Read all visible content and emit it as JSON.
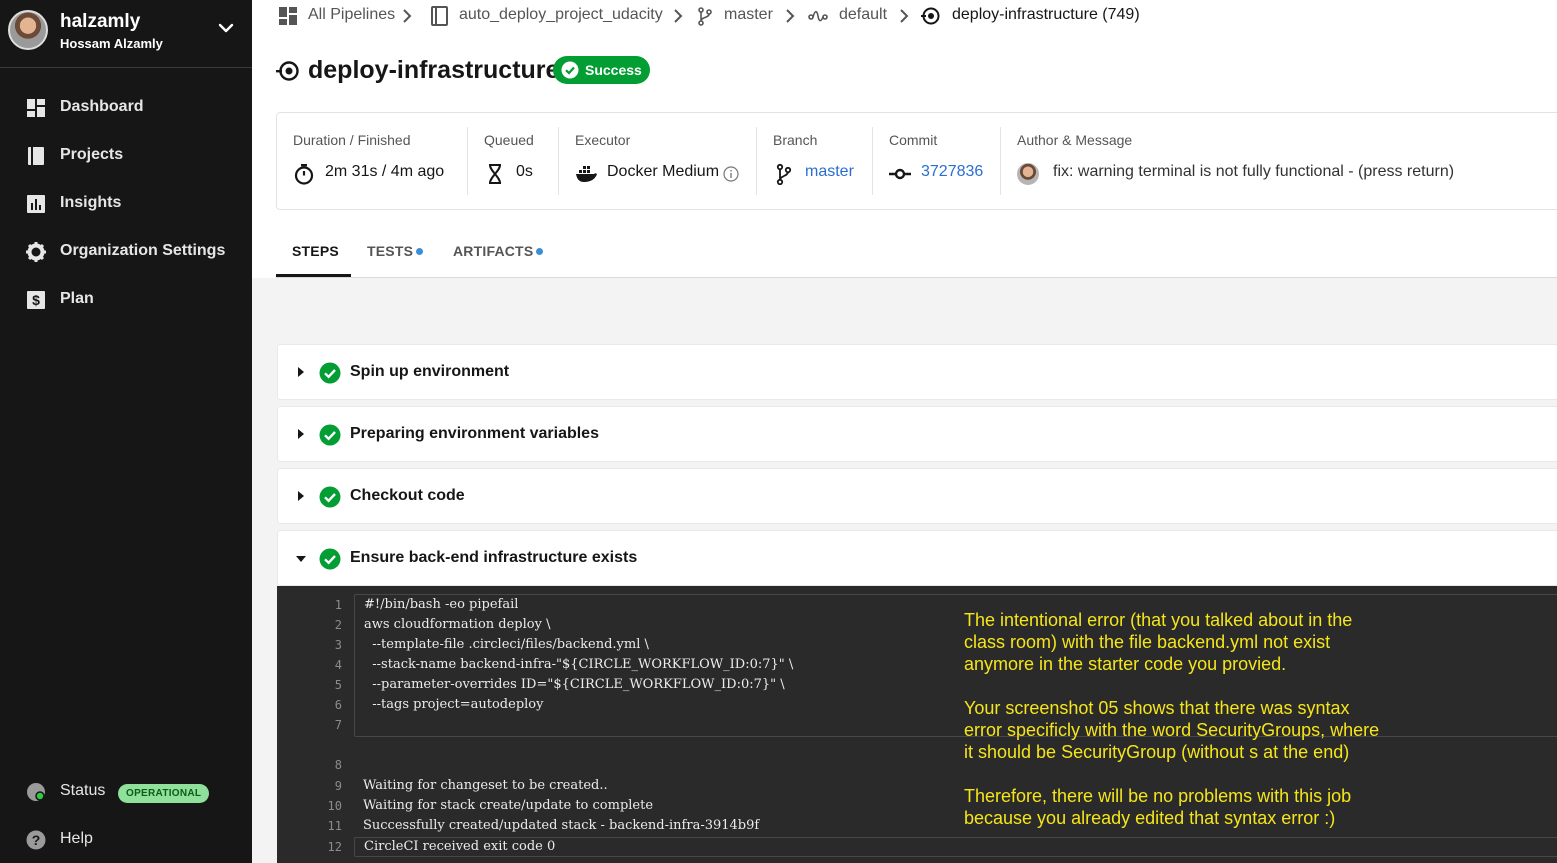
{
  "sidebar": {
    "user_handle": "halzamly",
    "user_name": "Hossam Alzamly",
    "items": [
      {
        "label": "Dashboard",
        "icon": "dashboard-icon"
      },
      {
        "label": "Projects",
        "icon": "projects-icon"
      },
      {
        "label": "Insights",
        "icon": "insights-icon"
      },
      {
        "label": "Organization Settings",
        "icon": "gear-icon"
      },
      {
        "label": "Plan",
        "icon": "dollar-icon"
      }
    ],
    "status_label": "Status",
    "status_badge": "OPERATIONAL",
    "help_label": "Help"
  },
  "breadcrumb": {
    "all_pipelines": "All Pipelines",
    "project": "auto_deploy_project_udacity",
    "branch": "master",
    "workflow": "default",
    "job": "deploy-infrastructure (749)"
  },
  "job": {
    "title": "deploy-infrastructure",
    "status": "Success"
  },
  "info": {
    "duration_label": "Duration / Finished",
    "duration_value": "2m 31s / 4m ago",
    "queued_label": "Queued",
    "queued_value": "0s",
    "executor_label": "Executor",
    "executor_value": "Docker Medium",
    "branch_label": "Branch",
    "branch_value": "master",
    "commit_label": "Commit",
    "commit_value": "3727836",
    "author_label": "Author & Message",
    "author_message": "fix: warning terminal is not fully functional - (press return)"
  },
  "tabs": {
    "steps": "STEPS",
    "tests": "TESTS",
    "artifacts": "ARTIFACTS"
  },
  "steps": [
    {
      "name": "Spin up environment",
      "expanded": false
    },
    {
      "name": "Preparing environment variables",
      "expanded": false
    },
    {
      "name": "Checkout code",
      "expanded": false
    },
    {
      "name": "Ensure back-end infrastructure exists",
      "expanded": true
    }
  ],
  "terminal": {
    "line_numbers": [
      "1",
      "2",
      "3",
      "4",
      "5",
      "6",
      "7",
      "8",
      "9",
      "10",
      "11",
      "12"
    ],
    "command_lines": [
      "#!/bin/bash -eo pipefail",
      "aws cloudformation deploy \\",
      "  --template-file .circleci/files/backend.yml \\",
      "  --stack-name backend-infra-\"${CIRCLE_WORKFLOW_ID:0:7}\" \\",
      "  --parameter-overrides ID=\"${CIRCLE_WORKFLOW_ID:0:7}\" \\",
      "  --tags project=autodeploy"
    ],
    "output_lines": [
      "Waiting for changeset to be created..",
      "Waiting for stack create/update to complete",
      "Successfully created/updated stack - backend-infra-3914b9f",
      "CircleCI received exit code 0"
    ]
  },
  "annotation": {
    "lines": [
      "The intentional error (that you talked about in the",
      "class room) with the file backend.yml not exist",
      "anymore in the starter code you provied.",
      "",
      "Your screenshot 05 shows that there was syntax",
      "error specificly with the word SecurityGroups, where",
      "it should be SecurityGroup (without s at the end)",
      "",
      "Therefore, there will be no problems with this job",
      "because you already edited that syntax error :)"
    ],
    "color": "#f5e51b"
  },
  "colors": {
    "sidebar_bg": "#161616",
    "success": "#039e33",
    "link": "#2a6fcf",
    "terminal_bg": "#2a2a2a"
  }
}
